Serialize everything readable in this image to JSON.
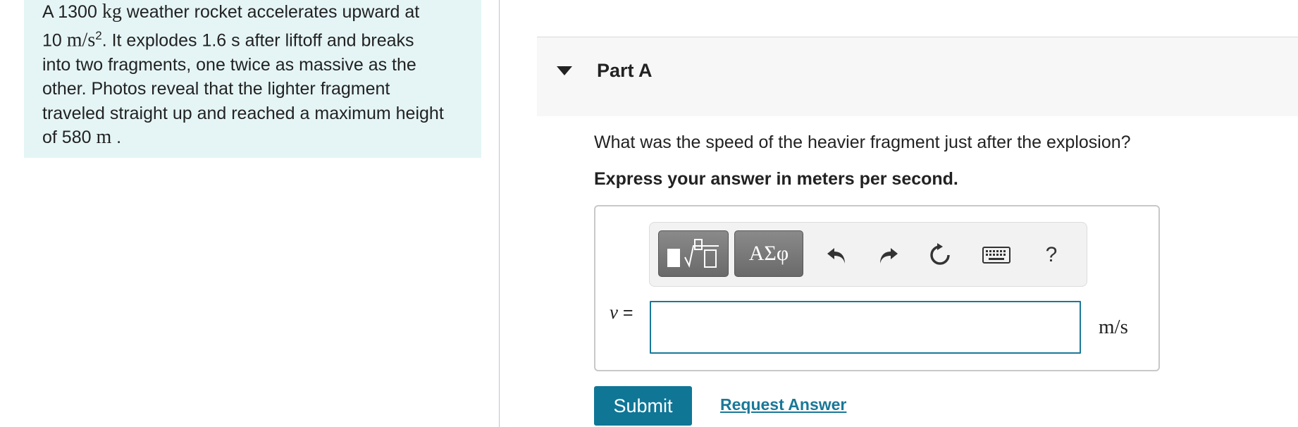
{
  "problem": {
    "line1_a": "A 1300 ",
    "mass_unit": "kg",
    "line1_b": " weather rocket accelerates upward at",
    "accel_value": "10 ",
    "accel_unit": "m/s",
    "accel_exp": "2",
    "line2_b": ". It explodes 1.6  s after liftoff and breaks",
    "line3": "into two fragments, one twice as massive as the",
    "line4": "other. Photos reveal that the lighter fragment",
    "line5": "traveled straight up and reached a maximum height",
    "line6_a": "of 580 ",
    "height_unit": "m",
    "line6_b": " ."
  },
  "part": {
    "title": "Part A"
  },
  "question": "What was the speed of the heavier fragment just after the explosion?",
  "instruction": "Express your answer in meters per second.",
  "toolbar": {
    "greek_label": "ΑΣφ",
    "help_label": "?",
    "icons": [
      "templates-icon",
      "greek-symbols-icon",
      "undo-icon",
      "redo-icon",
      "reset-icon",
      "keyboard-icon",
      "help-icon"
    ]
  },
  "answer": {
    "variable": "v",
    "equals": " =",
    "value": "",
    "unit": "m/s"
  },
  "actions": {
    "submit_label": "Submit",
    "request_label": "Request Answer"
  },
  "colors": {
    "accent": "#0f7696",
    "problem_bg": "#e5f5f6",
    "input_border": "#1a7898"
  }
}
